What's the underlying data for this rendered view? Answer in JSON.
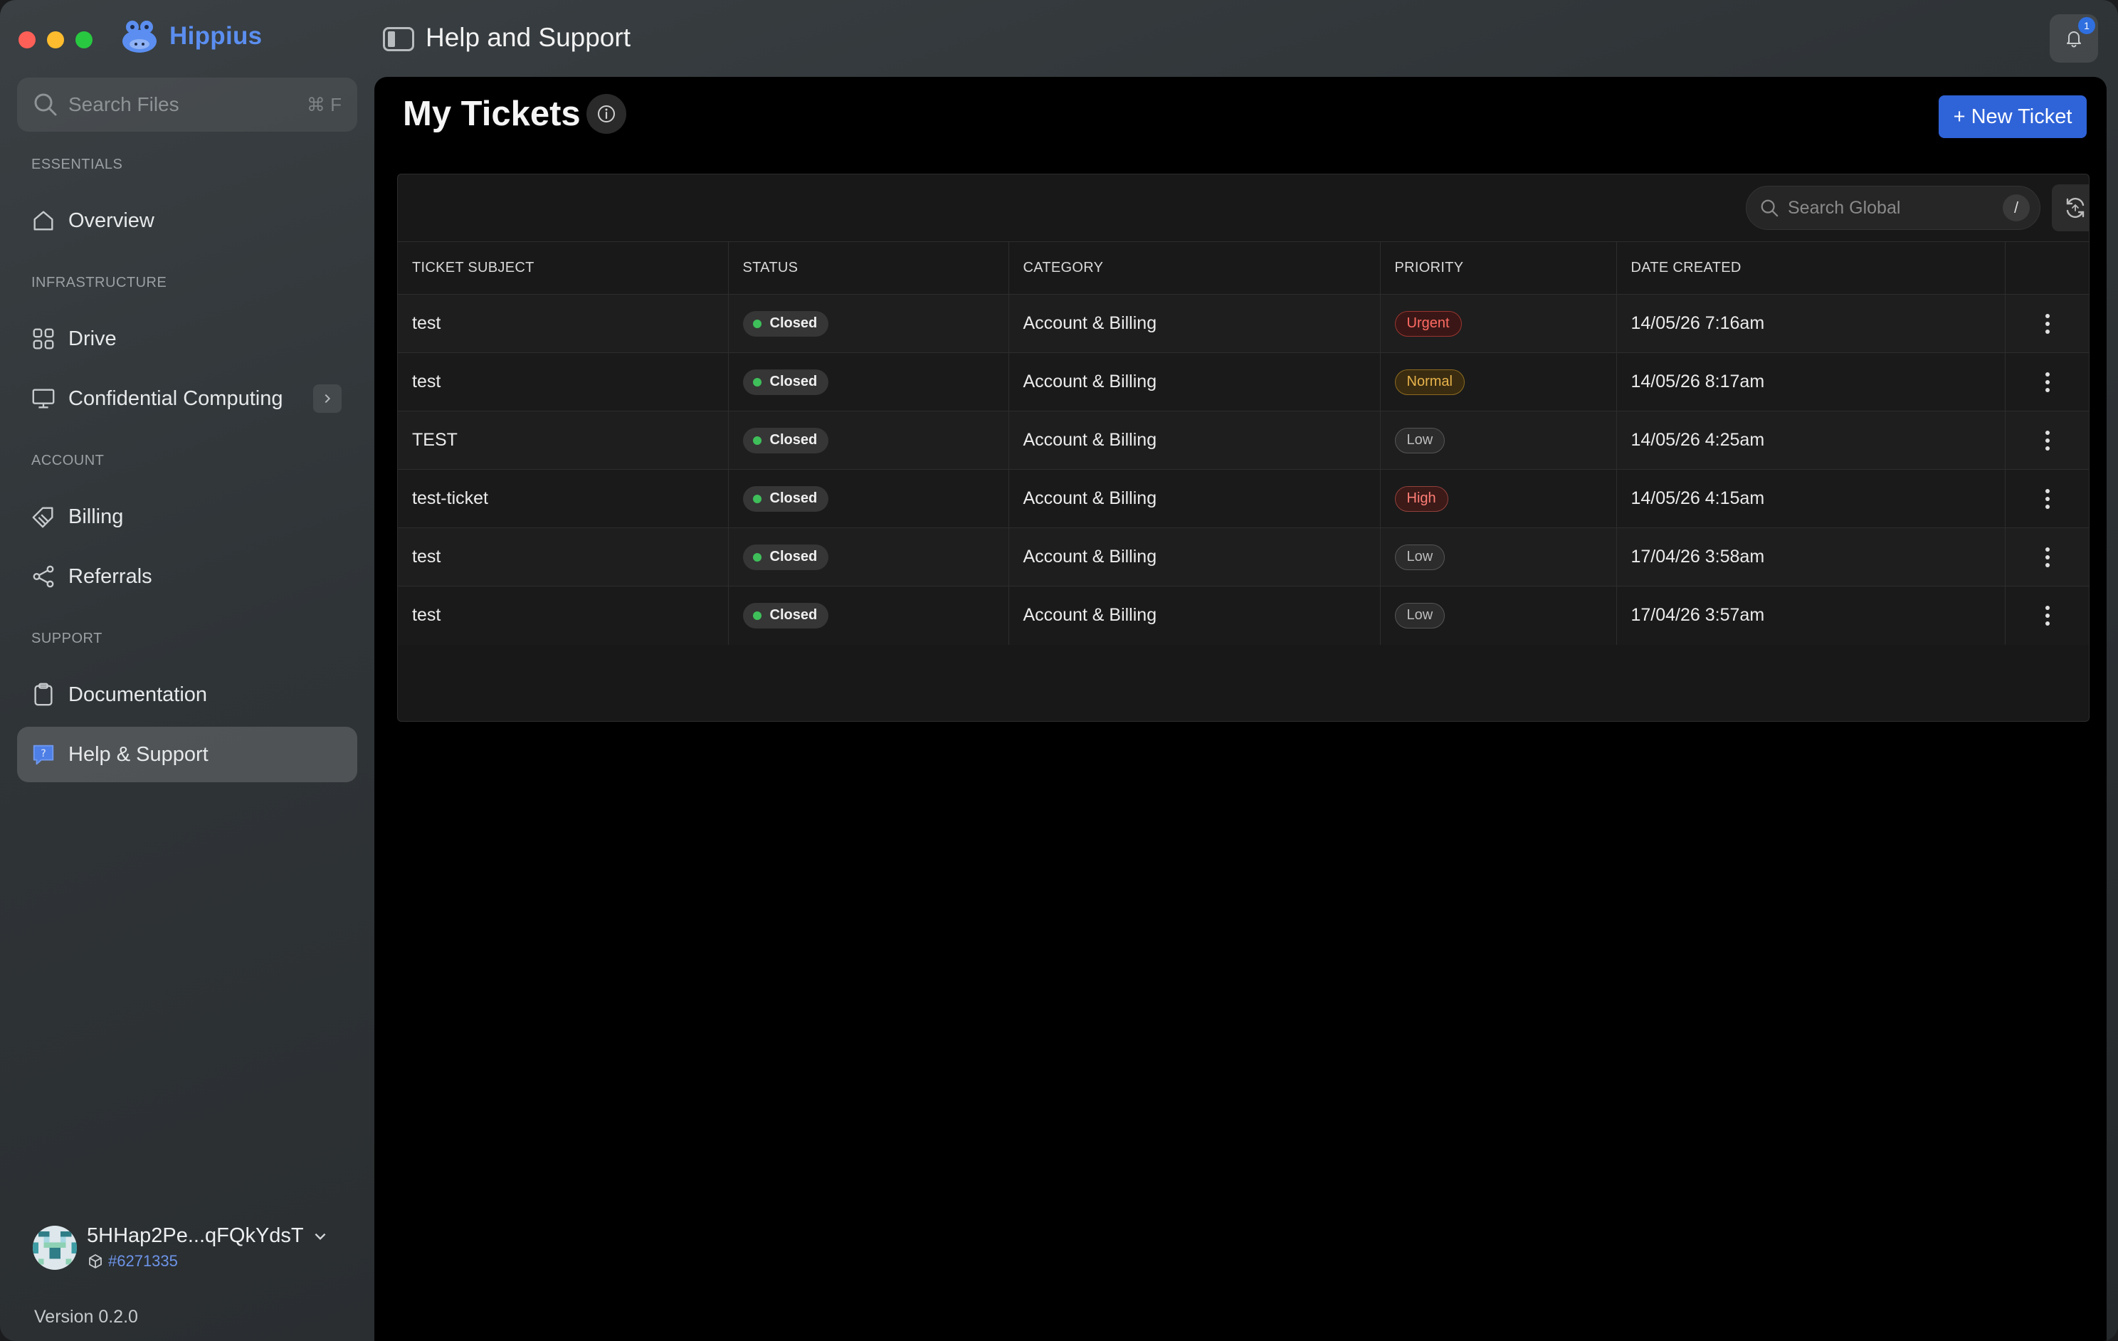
{
  "app": {
    "name": "Hippius",
    "window_title": "Help and Support"
  },
  "sidebar": {
    "search": {
      "placeholder": "Search Files",
      "shortcut": "⌘ F"
    },
    "sections": {
      "essentials": "ESSENTIALS",
      "infrastructure": "INFRASTRUCTURE",
      "account": "ACCOUNT",
      "support": "SUPPORT"
    },
    "items": {
      "overview": "Overview",
      "drive": "Drive",
      "confidential": "Confidential Computing",
      "billing": "Billing",
      "referrals": "Referrals",
      "documentation": "Documentation",
      "help": "Help & Support"
    },
    "active_item": "help",
    "user": {
      "address": "5HHap2Pe...qFQkYdsT",
      "number": "#6271335"
    },
    "version": "Version 0.2.0"
  },
  "topbar": {
    "notification_count": "1",
    "notification_icon": "bell-icon"
  },
  "main": {
    "title": "My Tickets",
    "new_ticket_label": "+ New Ticket",
    "search": {
      "placeholder": "Search Global",
      "shortcut": "/"
    },
    "table": {
      "columns": [
        "TICKET SUBJECT",
        "STATUS",
        "CATEGORY",
        "PRIORITY",
        "DATE CREATED"
      ],
      "rows": [
        {
          "subject": "test",
          "status": "Closed",
          "category": "Account & Billing",
          "priority": "Urgent",
          "date": "14/05/26 7:16am"
        },
        {
          "subject": "test",
          "status": "Closed",
          "category": "Account & Billing",
          "priority": "Normal",
          "date": "14/05/26 8:17am"
        },
        {
          "subject": "TEST",
          "status": "Closed",
          "category": "Account & Billing",
          "priority": "Low",
          "date": "14/05/26 4:25am"
        },
        {
          "subject": "test-ticket",
          "status": "Closed",
          "category": "Account & Billing",
          "priority": "High",
          "date": "14/05/26 4:15am"
        },
        {
          "subject": "test",
          "status": "Closed",
          "category": "Account & Billing",
          "priority": "Low",
          "date": "17/04/26 3:58am"
        },
        {
          "subject": "test",
          "status": "Closed",
          "category": "Account & Billing",
          "priority": "Low",
          "date": "17/04/26 3:57am"
        }
      ]
    }
  },
  "colors": {
    "accent": "#2f63d8",
    "brand": "#5b8ef0",
    "status_closed_dot": "#3fbf5a",
    "priority_urgent": "#ff6b63",
    "priority_normal": "#e7b34c",
    "priority_low": "#bdbdbd",
    "priority_high": "#ff7d75"
  }
}
